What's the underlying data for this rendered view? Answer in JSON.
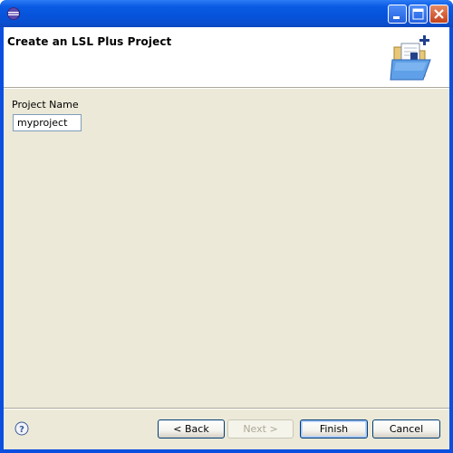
{
  "window": {
    "title": ""
  },
  "header": {
    "title": "Create an LSL Plus Project",
    "icon": "new-project-folder-icon"
  },
  "form": {
    "project_name_label": "Project Name",
    "project_name_value": "myproject"
  },
  "footer": {
    "help_icon": "help-icon",
    "back_label": "< Back",
    "next_label": "Next >",
    "finish_label": "Finish",
    "cancel_label": "Cancel"
  },
  "colors": {
    "titlebar": "#0a5ae3",
    "dialog_bg": "#ece9d8",
    "header_bg": "#ffffff"
  }
}
